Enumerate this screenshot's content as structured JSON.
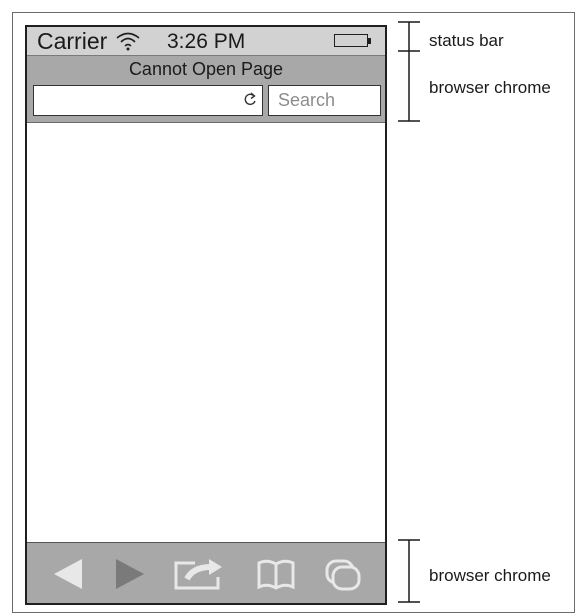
{
  "status_bar": {
    "carrier": "Carrier",
    "time": "3:26 PM",
    "wifi_icon": "wifi-icon",
    "battery_icon": "battery-icon"
  },
  "browser": {
    "page_title": "Cannot Open Page",
    "url_value": "",
    "reload_icon": "reload-icon",
    "search_placeholder": "Search"
  },
  "toolbar": {
    "items": [
      "back-icon",
      "forward-icon",
      "share-icon",
      "bookmarks-icon",
      "tabs-icon"
    ]
  },
  "annotations": {
    "status_bar": "status bar",
    "browser_chrome_top": "browser chrome",
    "browser_chrome_bottom": "browser chrome"
  },
  "colors": {
    "bar_gray": "#a8a8a8",
    "status_gray": "#d2d2d2",
    "icon_gray": "#e8e8e8"
  }
}
